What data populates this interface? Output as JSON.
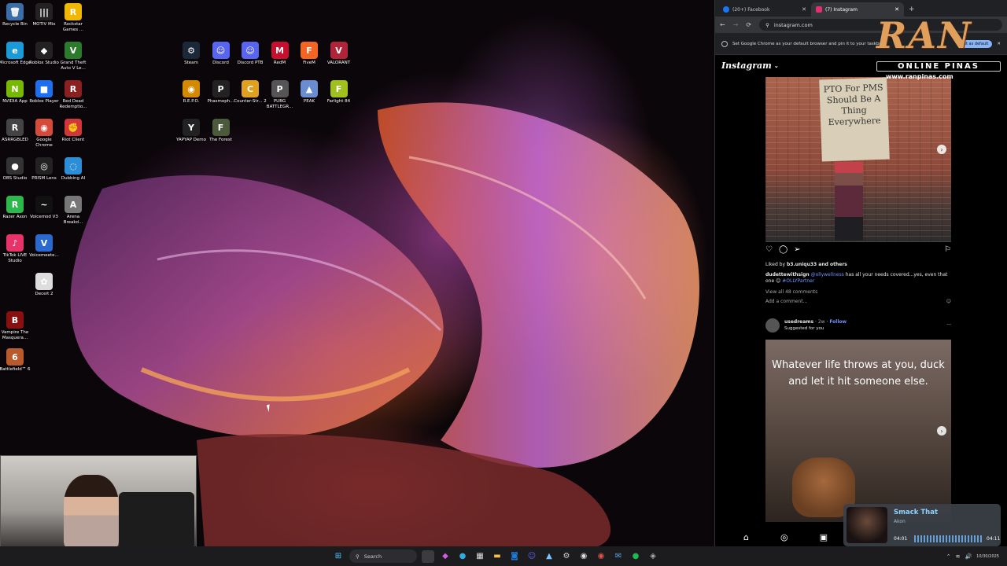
{
  "desktop": {
    "icons_col1": [
      {
        "label": "Recycle Bin",
        "glyph": "🗑",
        "color": "#3b6ea8"
      },
      {
        "label": "Microsoft Edge",
        "glyph": "e",
        "color": "#1a9ad6"
      },
      {
        "label": "NVIDIA App",
        "glyph": "N",
        "color": "#76b900"
      },
      {
        "label": "ASRRGBLED",
        "glyph": "R",
        "color": "#444"
      },
      {
        "label": "OBS Studio",
        "glyph": "●",
        "color": "#333"
      },
      {
        "label": "Razer Axon",
        "glyph": "R",
        "color": "#2db84c"
      },
      {
        "label": "TikTok LIVE Studio",
        "glyph": "♪",
        "color": "#e8326a"
      },
      {
        "label": "Vampire The Masquera...",
        "glyph": "B",
        "color": "#8a1010"
      },
      {
        "label": "Battlefield™ 6",
        "glyph": "6",
        "color": "#b85a2c"
      }
    ],
    "icons_col2": [
      {
        "label": "MOTIV Mix",
        "glyph": "|||",
        "color": "#222"
      },
      {
        "label": "Roblox Studio",
        "glyph": "◆",
        "color": "#222"
      },
      {
        "label": "Roblox Player",
        "glyph": "■",
        "color": "#1e6ff0"
      },
      {
        "label": "Google Chrome",
        "glyph": "◉",
        "color": "#d64a3a"
      },
      {
        "label": "PRISM Lens",
        "glyph": "◎",
        "color": "#222"
      },
      {
        "label": "Voicemod V3",
        "glyph": "~",
        "color": "#111"
      },
      {
        "label": "Voicemeete...",
        "glyph": "V",
        "color": "#2a6ad0"
      },
      {
        "label": "Deceit 2",
        "glyph": "✿",
        "color": "#ddd"
      }
    ],
    "icons_col3": [
      {
        "label": "Rockstar Games ...",
        "glyph": "R",
        "color": "#f0b800"
      },
      {
        "label": "Grand Theft Auto V Le...",
        "glyph": "V",
        "color": "#2c7a2c"
      },
      {
        "label": "Red Dead Redemptio...",
        "glyph": "R",
        "color": "#8b2020"
      },
      {
        "label": "Riot Client",
        "glyph": "✊",
        "color": "#d13639"
      },
      {
        "label": "Dubbing AI",
        "glyph": "◌",
        "color": "#2d8ed8"
      },
      {
        "label": "Arena Breakd...",
        "glyph": "A",
        "color": "#777"
      }
    ],
    "icons_row_top": [
      {
        "label": "Steam",
        "glyph": "⚙",
        "color": "#1b2838"
      },
      {
        "label": "Discord",
        "glyph": "☺",
        "color": "#5865f2"
      },
      {
        "label": "Discord PTB",
        "glyph": "☺",
        "color": "#5865f2"
      },
      {
        "label": "RedM",
        "glyph": "M",
        "color": "#c8102e"
      },
      {
        "label": "FiveM",
        "glyph": "F",
        "color": "#f26522"
      },
      {
        "label": "VALORANT",
        "glyph": "V",
        "color": "#b0243a"
      }
    ],
    "icons_row_mid": [
      {
        "label": "R.E.P.O.",
        "glyph": "◉",
        "color": "#d48a00"
      },
      {
        "label": "Phasmoph...",
        "glyph": "P",
        "color": "#222"
      },
      {
        "label": "Counter-Str... 2",
        "glyph": "C",
        "color": "#e0a020"
      },
      {
        "label": "PUBG BATTLEGR...",
        "glyph": "P",
        "color": "#555"
      },
      {
        "label": "PEAK",
        "glyph": "▲",
        "color": "#6a8cd0"
      },
      {
        "label": "Farlight 84",
        "glyph": "F",
        "color": "#a0c020"
      }
    ],
    "icons_row_low": [
      {
        "label": "YAPYAP Demo",
        "glyph": "Y",
        "color": "#222"
      },
      {
        "label": "The Forest",
        "glyph": "F",
        "color": "#4a5a3a"
      }
    ]
  },
  "browser": {
    "tabs": [
      {
        "label": "(20+) Facebook",
        "icon": "facebook-icon",
        "color": "#1877f2",
        "active": false
      },
      {
        "label": "(7) Instagram",
        "icon": "instagram-icon",
        "color": "#e1306c",
        "active": true
      }
    ],
    "url": "instagram.com",
    "infobar": "Set Google Chrome as your default browser and pin it to your taskbar",
    "infobar_button": "Set as default"
  },
  "instagram": {
    "logo": "Instagram",
    "post1": {
      "sign_text": "PTO For PMS Should Be A Thing Everywhere",
      "liked_by_prefix": "Liked by ",
      "liked_by_user": "b3.uniqu33",
      "liked_by_suffix": " and others",
      "caption_user": "dudettewithsign",
      "caption_mention": "@ollywellness",
      "caption_text": " has all your needs covered...yes, even that one 😊 ",
      "caption_tag": "#OLLYPartner",
      "comments": "View all 48 comments",
      "add_comment": "Add a comment..."
    },
    "post2": {
      "user": "usedreams",
      "age": "2w",
      "follow": "Follow",
      "suggested": "Suggested for you",
      "quote": "Whatever life throws at you, duck and let it hit someone else."
    }
  },
  "music": {
    "title": "Smack That",
    "artist": "Akon",
    "elapsed": "04:01",
    "total": "04:11"
  },
  "overlay_logo": {
    "brand": "RAN",
    "subtitle": "ONLINE PINAS",
    "site": "www.ranpinas.com"
  },
  "taskbar": {
    "search_label": "Search",
    "date": "10/30/2025"
  }
}
